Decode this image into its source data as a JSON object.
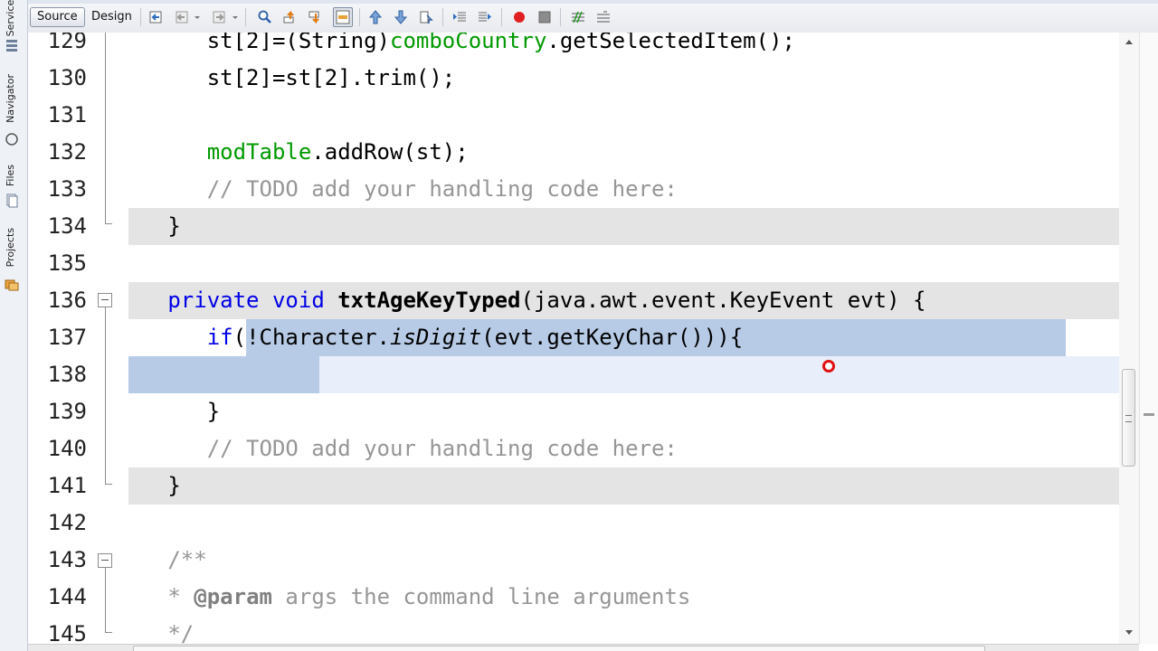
{
  "sidebar": {
    "tabs": [
      {
        "label": "Services",
        "icon": "services-icon"
      },
      {
        "label": "Navigator",
        "icon": "navigator-icon"
      },
      {
        "label": "Files",
        "icon": "files-icon"
      },
      {
        "label": "Projects",
        "icon": "projects-icon"
      }
    ]
  },
  "toolbar": {
    "source_label": "Source",
    "design_label": "Design",
    "icons": [
      "last-edit-icon",
      "back-icon",
      "forward-icon",
      "find-selection-icon",
      "find-previous-icon",
      "find-next-icon",
      "toggle-highlight-icon",
      "previous-bookmark-icon",
      "next-bookmark-icon",
      "toggle-bookmark-icon",
      "shift-left-icon",
      "shift-right-icon",
      "start-macro-icon",
      "stop-macro-icon",
      "comment-icon",
      "uncomment-icon"
    ]
  },
  "editor": {
    "lines": [
      {
        "num": "129",
        "text": "st[2]=(String)comboCountry.getSelectedItem();"
      },
      {
        "num": "130",
        "text": "st[2]=st[2].trim();"
      },
      {
        "num": "131",
        "text": ""
      },
      {
        "num": "132",
        "text": "modTable.addRow(st);"
      },
      {
        "num": "133",
        "text": "// TODO add your handling code here:"
      },
      {
        "num": "134",
        "text": "}"
      },
      {
        "num": "135",
        "text": ""
      },
      {
        "num": "136",
        "text": "private void txtAgeKeyTyped(java.awt.event.KeyEvent evt) {"
      },
      {
        "num": "137",
        "text": "if(!Character.isDigit(evt.getKeyChar())){"
      },
      {
        "num": "138",
        "text": ""
      },
      {
        "num": "139",
        "text": "}"
      },
      {
        "num": "140",
        "text": "// TODO add your handling code here:"
      },
      {
        "num": "141",
        "text": "}"
      },
      {
        "num": "142",
        "text": ""
      },
      {
        "num": "143",
        "text": "/**"
      },
      {
        "num": "144",
        "text": "* @param args the command line arguments"
      },
      {
        "num": "145",
        "text": "*/"
      }
    ],
    "tokens": {
      "st2_cast": "st[2]=(String)",
      "comboCountry": "comboCountry",
      "getSelected": ".getSelectedItem();",
      "trim": "st[2]=st[2].trim();",
      "modTable": "modTable",
      "addRow": ".addRow(st);",
      "todo": "// TODO add your handling code here:",
      "close_brace": "}",
      "private": "private",
      "void": "void",
      "method_name": "txtAgeKeyTyped",
      "params": "(java.awt.event.KeyEvent evt) {",
      "if": "if",
      "paren": "(",
      "not_char": "!Character.",
      "isDigit": "isDigit",
      "getKey": "(evt.getKeyChar())){",
      "doc_open": "/**",
      "doc_star": "* ",
      "param_tag": "@param",
      "param_text": " args the command line arguments",
      "doc_close": "*/"
    }
  },
  "colors": {
    "keyword": "#0000e6",
    "field": "#009900",
    "comment": "#969696",
    "selection": "#b7cbe6",
    "current_line": "#e9effa",
    "brace_highlight": "#e4e4e4",
    "error": "#e01010"
  }
}
